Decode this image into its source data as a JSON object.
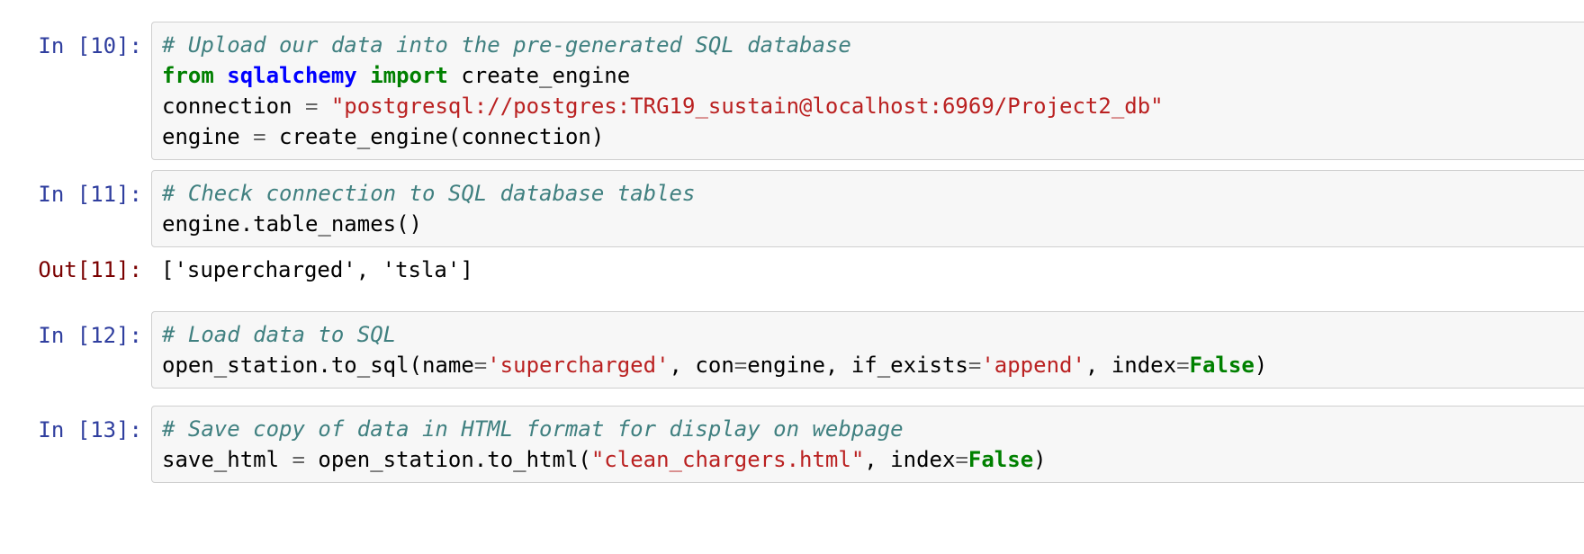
{
  "cells": [
    {
      "type": "input",
      "prompt": "In [10]:",
      "lines": [
        [
          {
            "t": "comment",
            "v": "# Upload our data into the pre-generated SQL database"
          }
        ],
        [
          {
            "t": "keyword",
            "v": "from"
          },
          {
            "t": "plain",
            "v": " "
          },
          {
            "t": "module",
            "v": "sqlalchemy"
          },
          {
            "t": "plain",
            "v": " "
          },
          {
            "t": "keyword",
            "v": "import"
          },
          {
            "t": "plain",
            "v": " create_engine"
          }
        ],
        [
          {
            "t": "plain",
            "v": "connection "
          },
          {
            "t": "op",
            "v": "="
          },
          {
            "t": "plain",
            "v": " "
          },
          {
            "t": "string",
            "v": "\"postgresql://postgres:TRG19_sustain@localhost:6969/Project2_db\""
          }
        ],
        [
          {
            "t": "plain",
            "v": "engine "
          },
          {
            "t": "op",
            "v": "="
          },
          {
            "t": "plain",
            "v": " create_engine(connection)"
          }
        ]
      ]
    },
    {
      "type": "input",
      "prompt": "In [11]:",
      "lines": [
        [
          {
            "t": "comment",
            "v": "# Check connection to SQL database tables"
          }
        ],
        [
          {
            "t": "plain",
            "v": "engine.table_names()"
          }
        ]
      ]
    },
    {
      "type": "output",
      "prompt": "Out[11]:",
      "lines": [
        [
          {
            "t": "plain",
            "v": "['supercharged', 'tsla']"
          }
        ]
      ]
    },
    {
      "type": "input",
      "prompt": "In [12]:",
      "lines": [
        [
          {
            "t": "comment",
            "v": "# Load data to SQL"
          }
        ],
        [
          {
            "t": "plain",
            "v": "open_station.to_sql(name"
          },
          {
            "t": "op",
            "v": "="
          },
          {
            "t": "string",
            "v": "'supercharged'"
          },
          {
            "t": "plain",
            "v": ", con"
          },
          {
            "t": "op",
            "v": "="
          },
          {
            "t": "plain",
            "v": "engine, if_exists"
          },
          {
            "t": "op",
            "v": "="
          },
          {
            "t": "string",
            "v": "'append'"
          },
          {
            "t": "plain",
            "v": ", index"
          },
          {
            "t": "op",
            "v": "="
          },
          {
            "t": "const",
            "v": "False"
          },
          {
            "t": "plain",
            "v": ")"
          }
        ]
      ]
    },
    {
      "type": "input",
      "prompt": "In [13]:",
      "lines": [
        [
          {
            "t": "comment",
            "v": "# Save copy of data in HTML format for display on webpage"
          }
        ],
        [
          {
            "t": "plain",
            "v": "save_html "
          },
          {
            "t": "op",
            "v": "="
          },
          {
            "t": "plain",
            "v": " open_station.to_html("
          },
          {
            "t": "string",
            "v": "\"clean_chargers.html\""
          },
          {
            "t": "plain",
            "v": ", index"
          },
          {
            "t": "op",
            "v": "="
          },
          {
            "t": "const",
            "v": "False"
          },
          {
            "t": "plain",
            "v": ")"
          }
        ]
      ]
    }
  ]
}
